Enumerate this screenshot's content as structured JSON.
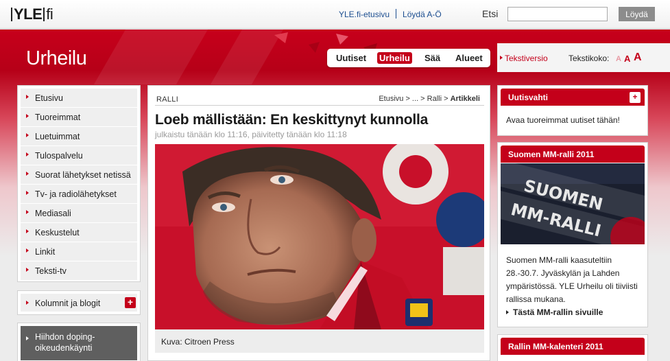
{
  "header": {
    "logo_left": "YLE",
    "logo_right": "fi",
    "links": [
      "YLE.fi-etusivu",
      "Löydä A-Ö"
    ],
    "search": {
      "label": "Etsi",
      "value": "",
      "button": "Löydä"
    }
  },
  "section": {
    "title": "Urheilu",
    "tabs": [
      {
        "label": "Uutiset",
        "active": false
      },
      {
        "label": "Urheilu",
        "active": true
      },
      {
        "label": "Sää",
        "active": false
      },
      {
        "label": "Alueet",
        "active": false
      }
    ],
    "text_version": "Tekstiversio",
    "text_size_label": "Tekstikoko:",
    "text_size_options": [
      "A",
      "A",
      "A"
    ]
  },
  "sidebar": {
    "items": [
      {
        "label": "Etusivu"
      },
      {
        "label": "Tuoreimmat"
      },
      {
        "label": "Luetuimmat"
      },
      {
        "label": "Tulospalvelu"
      },
      {
        "label": "Suorat lähetykset netissä"
      },
      {
        "label": "Tv- ja radiolähetykset"
      },
      {
        "label": "Mediasali"
      },
      {
        "label": "Keskustelut"
      },
      {
        "label": "Linkit"
      },
      {
        "label": "Teksti-tv"
      }
    ],
    "blogs": "Kolumnit ja blogit",
    "doping": "Hiihdon doping-oikeudenkäynti"
  },
  "article": {
    "category": "RALLI",
    "breadcrumb": {
      "path": "Etusivu > ... > Ralli >",
      "current": "Artikkeli"
    },
    "headline": "Loeb mällistään: En keskittynyt kunnolla",
    "published": "julkaistu tänään klo 11:16, päivitetty tänään klo 11:18",
    "caption": "Kuva: Citroen Press"
  },
  "right": {
    "uutisvahti": {
      "title": "Uutisvahti",
      "text": "Avaa tuoreimmat uutiset tähän!"
    },
    "mmralli": {
      "title": "Suomen MM-ralli 2011",
      "image_lines": [
        "SUOMEN",
        "MM-RALLI"
      ],
      "text": "Suomen MM-ralli kaasuteltiin 28.-30.7. Jyväskylän ja Lahden ympäristössä. YLE Urheilu oli tiiviisti rallissa mukana.",
      "link": "Tästä MM-rallin sivuille"
    },
    "kalenteri": {
      "title": "Rallin MM-kalenteri 2011"
    }
  },
  "colors": {
    "brand_red": "#c4001a",
    "link_blue": "#1b4d8f",
    "nav_bg": "#efefef"
  },
  "icons": [
    "plus-icon",
    "arrow-right-icon"
  ]
}
